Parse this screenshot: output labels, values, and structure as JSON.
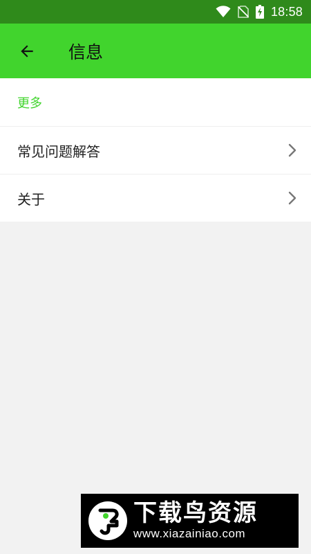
{
  "status_bar": {
    "time": "18:58",
    "icons": [
      "wifi-icon",
      "no-sim-icon",
      "battery-charging-icon"
    ]
  },
  "app_bar": {
    "back_icon": "arrow-left-icon",
    "title": "信息"
  },
  "section": {
    "header": "更多",
    "items": [
      {
        "label": "常见问题解答",
        "icon": "chevron-right-icon"
      },
      {
        "label": "关于",
        "icon": "chevron-right-icon"
      }
    ]
  },
  "watermark": {
    "title": "下载鸟资源",
    "url": "www.xiazainiao.com"
  },
  "colors": {
    "status_bar": "#2f8a1b",
    "app_bar": "#41d42d",
    "accent": "#41d42d",
    "background": "#f2f2f2"
  }
}
